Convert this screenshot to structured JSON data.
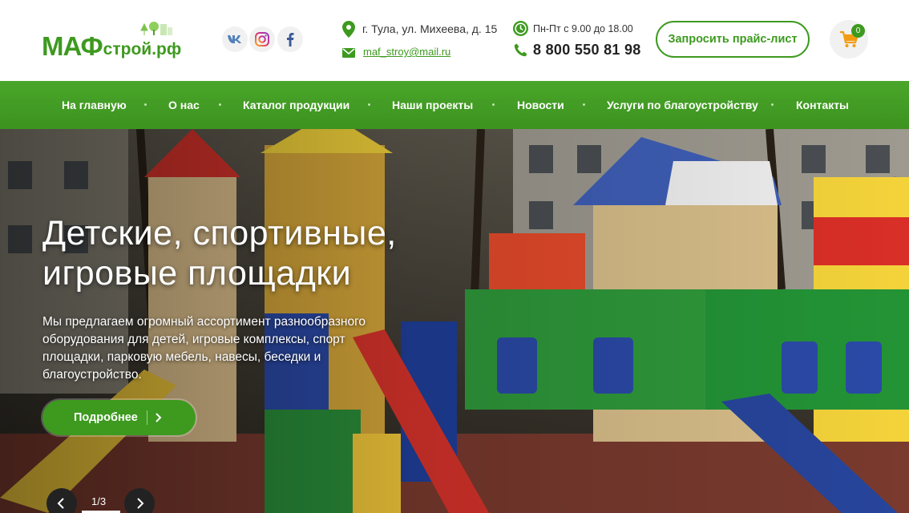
{
  "header": {
    "logo": {
      "main": "МАФ",
      "sub": "строй.рф"
    },
    "social": [
      {
        "icon": "vk-icon"
      },
      {
        "icon": "instagram-icon"
      },
      {
        "icon": "facebook-icon"
      }
    ],
    "address": "г. Тула, ул. Михеева, д. 15",
    "email": "maf_stroy@mail.ru",
    "hours": "Пн-Пт с 9.00 до 18.00",
    "phone": "8 800 550 81 98",
    "price_button": "Запросить прайс-лист",
    "cart_count": "0",
    "accent_color": "#3d9a1f"
  },
  "nav": {
    "items": [
      "На главную",
      "О нас",
      "Каталог продукции",
      "Наши проекты",
      "Новости",
      "Услуги по благоустройству",
      "Контакты"
    ]
  },
  "hero": {
    "title_line1": "Детские, спортивные,",
    "title_line2": "игровые площадки",
    "text": "Мы предлагаем огромный ассортимент разнообразного оборудования для детей, игровые комплексы, спорт площадки, парковую мебель, навесы, беседки и благоустройство.",
    "button": "Подробнее",
    "slider_counter": "1/3"
  }
}
